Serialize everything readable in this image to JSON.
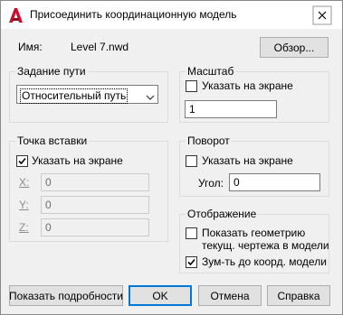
{
  "window": {
    "title": "Присоединить координационную модель",
    "accent_color": "#c8102e"
  },
  "name_row": {
    "label": "Имя:",
    "value": "Level 7.nwd",
    "browse_label": "Обзор..."
  },
  "path_group": {
    "legend": "Задание пути",
    "selected": "Относительный путь"
  },
  "scale_group": {
    "legend": "Масштаб",
    "specify_label": "Указать на экране",
    "specify_checked": false,
    "value": "1"
  },
  "insert_group": {
    "legend": "Точка вставки",
    "specify_label": "Указать на экране",
    "specify_checked": true,
    "x_label": "X:",
    "x_value": "0",
    "y_label": "Y:",
    "y_value": "0",
    "z_label": "Z:",
    "z_value": "0"
  },
  "rotation_group": {
    "legend": "Поворот",
    "specify_label": "Указать на экране",
    "specify_checked": false,
    "angle_label": "Угол:",
    "angle_value": "0"
  },
  "display_group": {
    "legend": "Отображение",
    "show_geometry_line1": "Показать геометрию",
    "show_geometry_line2": "текущ. чертежа в модели",
    "show_geometry_checked": false,
    "zoom_label": "Зум-ть до коорд. модели",
    "zoom_checked": true
  },
  "buttons": {
    "details": "Показать подробности",
    "ok": "OK",
    "cancel": "Отмена",
    "help": "Справка"
  }
}
